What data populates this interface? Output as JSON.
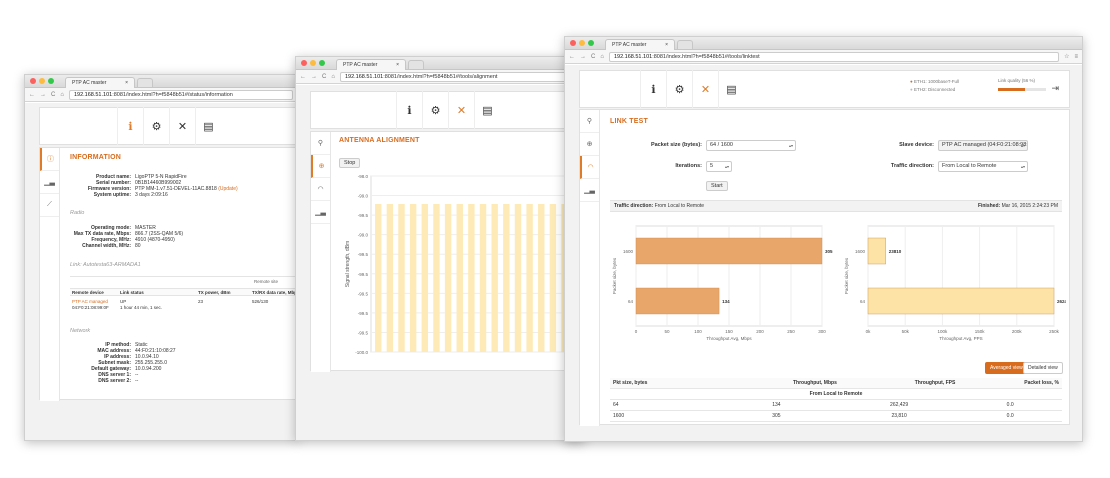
{
  "colors": {
    "accent": "#d86c1e",
    "bar_dark": "#e8a66a",
    "bar_light": "#fde3a6",
    "grid_bars": "#fdeab6"
  },
  "win1": {
    "tab_title": "PTP AC master",
    "url_host": "192.168.51.101",
    "url_rest": ":8081/index.html?h=f5848b51#/status/information",
    "toolbar": [
      "info-icon",
      "gear-icon",
      "tools-icon",
      "router-icon"
    ],
    "side": [
      "info-icon",
      "chart-icon",
      "line-chart-icon"
    ],
    "section_title": "INFORMATION",
    "info": [
      {
        "k": "Product name:",
        "v": "LigoPTP 5-N RapidFire"
      },
      {
        "k": "Serial number:",
        "v": "0B1B14460B999002"
      },
      {
        "k": "Firmware version:",
        "v": "PTP MM-1.v7.51-DEVEL-11AC.8818",
        "link": "(Update)"
      },
      {
        "k": "System uptime:",
        "v": "3 days 2:09:16"
      }
    ],
    "radio_label": "Radio",
    "radio": [
      {
        "k": "Operating mode:",
        "v": "MASTER"
      },
      {
        "k": "Max TX data rate, Mbps:",
        "v": "866.7 (2SS-QAM 5/6)"
      },
      {
        "k": "Frequency, MHz:",
        "v": "4910 (4870-4950)"
      },
      {
        "k": "Channel width, MHz:",
        "v": "80"
      }
    ],
    "link_label": "Link: Autotesta63-ARMADA1",
    "remote_site": "Remote site",
    "link_headers": [
      "Remote device",
      "Link status",
      "TX power, dBm",
      "TX/RX data rate, Mbp"
    ],
    "link_row": {
      "device": "PTP AC managed",
      "mac": "04:F0:21:08:99:0F",
      "status": "UP",
      "uptime": "1 hour 44 min, 1 sec.",
      "tx": "23",
      "rate": "526/130"
    },
    "network_label": "Network",
    "network": [
      {
        "k": "IP method:",
        "v": "Static"
      },
      {
        "k": "MAC address:",
        "v": "44:F0:21:10:08:27"
      },
      {
        "k": "IP address:",
        "v": "10.0.94.10"
      },
      {
        "k": "Subnet mask:",
        "v": "255.255.255.0"
      },
      {
        "k": "Default gateway:",
        "v": "10.0.94.200"
      },
      {
        "k": "DNS server 1:",
        "v": "--"
      },
      {
        "k": "DNS server 2:",
        "v": "--"
      }
    ]
  },
  "win2": {
    "tab_title": "PTP AC master",
    "url_host": "192.168.51.101",
    "url_rest": ":8081/index.html?h=f5848b51#/tools/alignment",
    "side": [
      "search-icon",
      "target-icon",
      "gauge-icon",
      "chart-icon"
    ],
    "section_title": "ANTENNA ALIGNMENT",
    "stop_label": "Stop",
    "y_axis_label": "Signal strength, dBm",
    "y_ticks": [
      "-98.0",
      "-99.0",
      "-99.5",
      "-99.0",
      "-99.5",
      "-99.5",
      "-99.5",
      "-99.5",
      "-99.5",
      "-100.0"
    ],
    "bar_count": 17
  },
  "win3": {
    "tab_title": "PTP AC master",
    "url_host": "192.168.51.101",
    "url_rest": ":8081/index.html?h=f5848b51#/tools/linktest",
    "status": {
      "eth1": "ETH1: 1000baseT-Full",
      "eth2": "ETH2: Disconnected",
      "link_quality": "Link quality (56 %)"
    },
    "side": [
      "search-icon",
      "target-icon",
      "gauge-icon",
      "chart-icon"
    ],
    "section_title": "LINK TEST",
    "packet_size_label": "Packet size (bytes):",
    "packet_size_value": "64 / 1600",
    "iterations_label": "Iterations:",
    "iterations_value": "5",
    "slave_label": "Slave device:",
    "slave_value": "PTP AC managed (04:F0:21:08:98:0",
    "direction_label": "Traffic direction:",
    "direction_value": "From Local to Remote",
    "start_label": "Start",
    "summary_left_label": "Traffic direction:",
    "summary_left_value": "From Local to Remote",
    "summary_right_label": "Finished:",
    "summary_right_value": "Mar 16, 2015 2:24:23 PM",
    "averaged_view": "Averaged view",
    "detailed_view": "Detailed view",
    "table_headers": [
      "Pkt size, bytes",
      "Throughput, Mbps",
      "Throughput, FPS",
      "Packet loss, %"
    ],
    "table_group": "From Local to Remote",
    "table_rows": [
      {
        "size": "64",
        "mbps": "134",
        "fps": "262,429",
        "loss": "0.0"
      },
      {
        "size": "1600",
        "mbps": "305",
        "fps": "23,810",
        "loss": "0.0"
      }
    ]
  },
  "chart_data": [
    {
      "type": "bar",
      "orientation": "horizontal",
      "categories": [
        "1600",
        "64"
      ],
      "values": [
        305,
        134
      ],
      "xlabel": "Throughput Avg, Mbps",
      "ylabel": "Packet size, bytes",
      "xlim": [
        0,
        300
      ],
      "x_ticks": [
        "0",
        "50",
        "100",
        "150",
        "200",
        "250",
        "300"
      ]
    },
    {
      "type": "bar",
      "orientation": "horizontal",
      "categories": [
        "1600",
        "64"
      ],
      "values": [
        23810,
        262429
      ],
      "xlabel": "Throughput Avg, PPS",
      "ylabel": "Packet size, bytes",
      "xlim": [
        0,
        250000
      ],
      "x_ticks": [
        "0k",
        "50k",
        "100k",
        "150k",
        "200k",
        "250k"
      ]
    }
  ]
}
